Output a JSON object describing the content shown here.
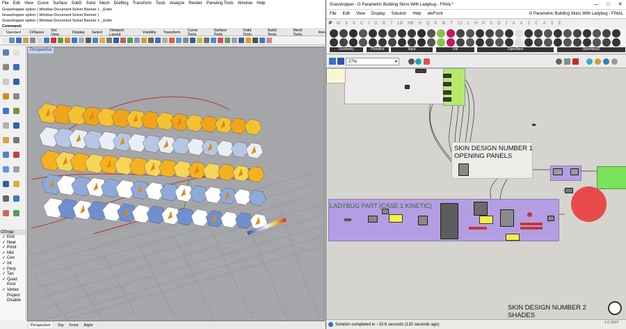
{
  "rhino": {
    "menu": [
      "File",
      "Edit",
      "View",
      "Curve",
      "Surface",
      "SubD",
      "Solid",
      "Mesh",
      "Drafting",
      "Transform",
      "Tools",
      "Analyze",
      "Render",
      "Paneling Tools",
      "Window",
      "Help"
    ],
    "cmd_lines": [
      "Grasshopper option ( Window  Document  Solver  Banner ): _Enter",
      "Grasshopper option ( Window  Document  Solver  Banner )"
    ],
    "cmd_prompt": "Command:",
    "toolbar_tabs": [
      "Standard",
      "CPlanes",
      "Set View",
      "Display",
      "Select",
      "Viewport Layout",
      "Visibility",
      "Transform",
      "Curve Tools",
      "Surface Tools",
      "Solid Tools",
      "SubD Tools",
      "Mesh Tools",
      "Ren"
    ],
    "viewport_label": "Perspective",
    "view_tabs": [
      "Perspective",
      "Top",
      "Front",
      "Right"
    ],
    "osnap_header": "OSnap",
    "osnap": [
      {
        "label": "End",
        "checked": true
      },
      {
        "label": "Near",
        "checked": true
      },
      {
        "label": "Point",
        "checked": true
      },
      {
        "label": "Mid",
        "checked": true
      },
      {
        "label": "Cen",
        "checked": true
      },
      {
        "label": "Int",
        "checked": true
      },
      {
        "label": "Perp",
        "checked": true
      },
      {
        "label": "Tan",
        "checked": true
      },
      {
        "label": "Quad",
        "checked": true
      },
      {
        "label": "Knot",
        "checked": false
      },
      {
        "label": "Vertex",
        "checked": true
      },
      {
        "label": "Project",
        "checked": false
      },
      {
        "label": "Disable",
        "checked": false
      }
    ]
  },
  "grasshopper": {
    "title": "Grasshopper - G Parametric Building Skins With Ladybug - FINAL*",
    "menu": [
      "File",
      "Edit",
      "View",
      "Display",
      "Solution",
      "Help",
      "eleFront"
    ],
    "doc_name": "G Parametric Building Skins With Ladybug - FINAL",
    "category_tabs": [
      "P",
      "M",
      "S",
      "V",
      "C",
      "I",
      "G",
      "R",
      "T",
      "LB",
      "HB",
      "H",
      "Q",
      "K",
      "M",
      "F",
      "Cr",
      "L",
      "H",
      "P",
      "S",
      "D",
      "J",
      "A",
      "A",
      "Z",
      "C",
      "A",
      "S",
      "E"
    ],
    "ribbon_sections": [
      "Geometry",
      "Primitive",
      "Input",
      "Util",
      "OpenNest",
      "OpenNest2"
    ],
    "zoom": "27%",
    "groups": {
      "skin1": "SKIN DESIGN NUMBER 1\nOPENING PANELS",
      "ladybug": "LADYBUG PART (CASE 1 KINETIC)",
      "skin2": "SKIN DESIGN NUMBER 2\nSHADES"
    },
    "status": "Solution completed in ~10.6 seconds (130 seconds ago)",
    "version": "1.0.0007",
    "accent": "#8ce04a",
    "group_purple": "#b59de3",
    "bubble_red": "#e84a4a"
  }
}
